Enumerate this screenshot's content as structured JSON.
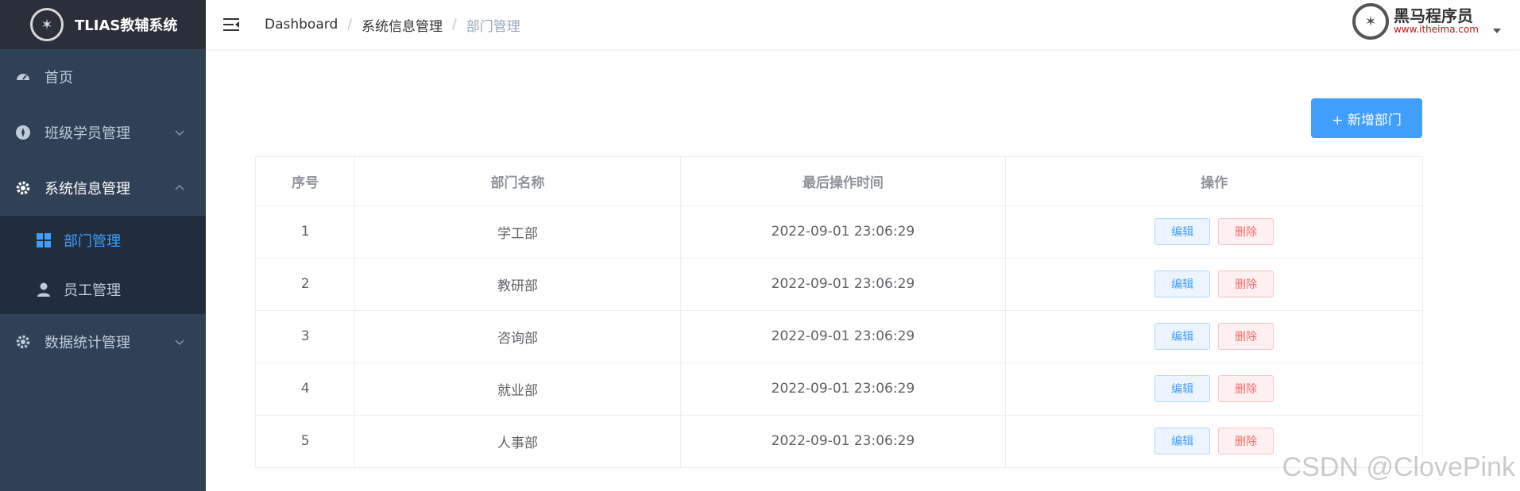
{
  "app": {
    "title": "TLIAS教辅系统"
  },
  "sidebar": {
    "items": [
      {
        "label": "首页",
        "icon": "dashboard-icon"
      },
      {
        "label": "班级学员管理",
        "icon": "compass-icon",
        "expanded": false
      },
      {
        "label": "系统信息管理",
        "icon": "gear-icon",
        "expanded": true,
        "children": [
          {
            "label": "部门管理",
            "icon": "grid-icon",
            "active": true
          },
          {
            "label": "员工管理",
            "icon": "user-icon"
          }
        ]
      },
      {
        "label": "数据统计管理",
        "icon": "gear-icon",
        "expanded": false
      }
    ],
    "bg_color": "#304156",
    "active_color": "#409eff"
  },
  "navbar": {
    "breadcrumb": [
      "Dashboard",
      "系统信息管理",
      "部门管理"
    ],
    "brand_name": "黑马程序员",
    "brand_url": "www.itheima.com"
  },
  "main": {
    "add_button_label": "+ 新增部门",
    "table": {
      "headers": [
        "序号",
        "部门名称",
        "最后操作时间",
        "操作"
      ],
      "rows": [
        {
          "index": "1",
          "name": "学工部",
          "time": "2022-09-01 23:06:29"
        },
        {
          "index": "2",
          "name": "教研部",
          "time": "2022-09-01 23:06:29"
        },
        {
          "index": "3",
          "name": "咨询部",
          "time": "2022-09-01 23:06:29"
        },
        {
          "index": "4",
          "name": "就业部",
          "time": "2022-09-01 23:06:29"
        },
        {
          "index": "5",
          "name": "人事部",
          "time": "2022-09-01 23:06:29"
        }
      ],
      "edit_label": "编辑",
      "delete_label": "删除"
    }
  },
  "watermark": "CSDN @ClovePink"
}
